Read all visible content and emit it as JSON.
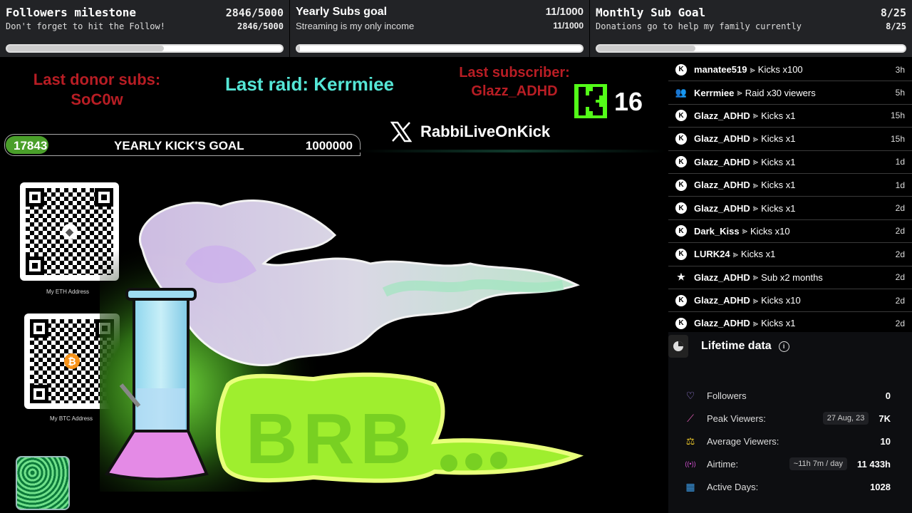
{
  "goals": [
    {
      "title": "Followers milestone",
      "count": "2846/5000",
      "desc": "Don't forget to hit the Follow!",
      "count2": "2846/5000",
      "progress": 0.569
    },
    {
      "title": "Yearly Subs goal",
      "count": "11/1000",
      "desc": "Streaming is my only income",
      "count2": "11/1000",
      "progress": 0.011
    },
    {
      "title": "Monthly Sub Goal",
      "count": "8/25",
      "desc": "Donations go to help my family currently",
      "count2": "8/25",
      "progress": 0.32
    }
  ],
  "labels": {
    "last_donor_title": "Last donor subs:",
    "last_donor_name": "SoC0w",
    "last_raid": "Last raid: Kerrmiee",
    "last_sub_title": "Last subscriber:",
    "last_sub_name": "Glazz_ADHD",
    "kick_count": "16"
  },
  "kick_goal": {
    "current": "17843",
    "label": "YEARLY KICK'S GOAL",
    "max": "1000000",
    "progress": 0.0178
  },
  "social": {
    "handle": "RabbiLiveOnKick",
    "icon": "x-logo-icon"
  },
  "qr": {
    "eth_caption": "My ETH Address",
    "btc_caption": "My BTC Address"
  },
  "activity": [
    {
      "icon": "kick-icon",
      "user": "manatee519",
      "event": "Kicks x100",
      "time": "3h"
    },
    {
      "icon": "raid-icon",
      "user": "Kerrmiee",
      "event": "Raid x30 viewers",
      "time": "5h"
    },
    {
      "icon": "kick-icon",
      "user": "Glazz_ADHD",
      "event": "Kicks x1",
      "time": "15h"
    },
    {
      "icon": "kick-icon",
      "user": "Glazz_ADHD",
      "event": "Kicks x1",
      "time": "15h"
    },
    {
      "icon": "kick-icon",
      "user": "Glazz_ADHD",
      "event": "Kicks x1",
      "time": "1d"
    },
    {
      "icon": "kick-icon",
      "user": "Glazz_ADHD",
      "event": "Kicks x1",
      "time": "1d"
    },
    {
      "icon": "kick-icon",
      "user": "Glazz_ADHD",
      "event": "Kicks x1",
      "time": "2d"
    },
    {
      "icon": "kick-icon",
      "user": "Dark_Kiss",
      "event": "Kicks x10",
      "time": "2d"
    },
    {
      "icon": "kick-icon",
      "user": "LURK24",
      "event": "Kicks x1",
      "time": "2d"
    },
    {
      "icon": "star-icon",
      "user": "Glazz_ADHD",
      "event": "Sub x2 months",
      "time": "2d"
    },
    {
      "icon": "kick-icon",
      "user": "Glazz_ADHD",
      "event": "Kicks x10",
      "time": "2d"
    },
    {
      "icon": "kick-icon",
      "user": "Glazz_ADHD",
      "event": "Kicks x1",
      "time": "2d"
    }
  ],
  "lifetime": {
    "title": "Lifetime data",
    "stats": [
      {
        "icon": "heart-icon",
        "color": "#a98bf5",
        "label": "Followers",
        "chip": "",
        "value": "0"
      },
      {
        "icon": "chart-icon",
        "color": "#e35db6",
        "label": "Peak Viewers:",
        "chip": "27 Aug, 23",
        "value": "7K"
      },
      {
        "icon": "scale-icon",
        "color": "#e6c229",
        "label": "Average Viewers:",
        "chip": "",
        "value": "10"
      },
      {
        "icon": "broadcast-icon",
        "color": "#d04fd0",
        "label": "Airtime:",
        "chip": "~11h 7m / day",
        "value": "11 433h"
      },
      {
        "icon": "calendar-icon",
        "color": "#3b9be6",
        "label": "Active Days:",
        "chip": "",
        "value": "1028"
      }
    ]
  }
}
